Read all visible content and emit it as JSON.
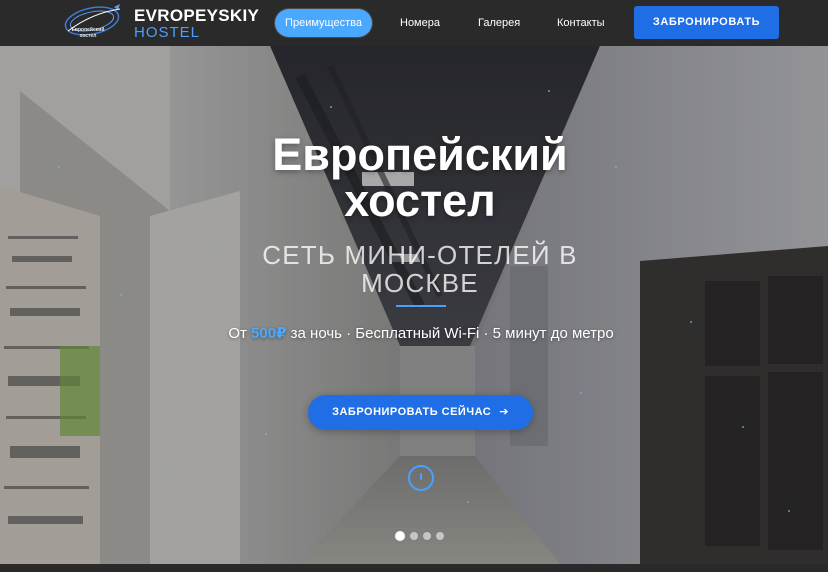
{
  "logo": {
    "title": "EVROPEYSKIY",
    "subtitle": "HOSTEL",
    "small_text": "Европейский хостел"
  },
  "nav": {
    "items": [
      {
        "label": "Преимущества",
        "active": true
      },
      {
        "label": "Номера",
        "active": false
      },
      {
        "label": "Галерея",
        "active": false
      },
      {
        "label": "Контакты",
        "active": false
      }
    ],
    "book_button": "ЗАБРОНИРОВАТЬ"
  },
  "hero": {
    "title": "Европейский хостел",
    "subtitle": "СЕТЬ МИНИ-ОТЕЛЕЙ В МОСКВЕ",
    "desc_prefix": "От ",
    "price": "500₽",
    "desc_suffix": " за ночь · Бесплатный Wi-Fi · 5 минут до метро",
    "cta_label": "ЗАБРОНИРОВАТЬ СЕЙЧАС",
    "cta_icon": "arrow-right-icon",
    "scroll_icon": "scroll-mouse-icon",
    "slides_total": 4,
    "slide_active": 1
  },
  "colors": {
    "accent": "#1f6ee6",
    "accent_light": "#4aa8ff",
    "header_bg": "#2a2a2a"
  }
}
